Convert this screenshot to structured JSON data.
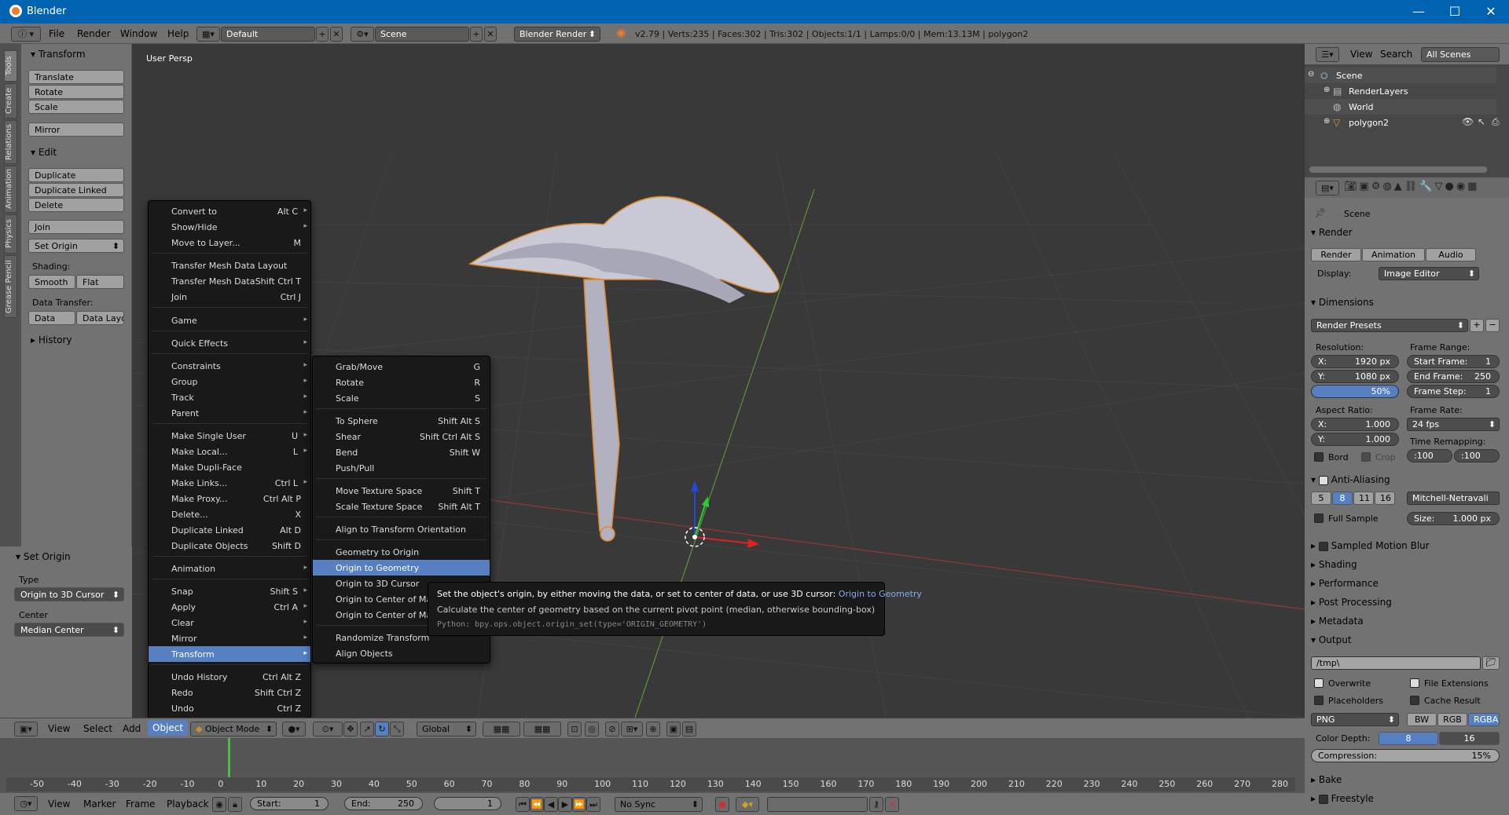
{
  "window": {
    "title": "Blender",
    "minimize": "—",
    "maximize": "☐",
    "close": "✕"
  },
  "main_header": {
    "menus": [
      "File",
      "Render",
      "Window",
      "Help"
    ],
    "layout": "Default",
    "scene": "Scene",
    "engine": "Blender Render",
    "stats": "v2.79 | Verts:235 | Faces:302 | Tris:302 | Objects:1/1 | Lamps:0/0 | Mem:13.13M | polygon2"
  },
  "left_tabs": [
    "Tools",
    "Create",
    "Relations",
    "Animation",
    "Physics",
    "Grease Pencil"
  ],
  "tool_shelf": {
    "transform_title": "Transform",
    "translate": "Translate",
    "rotate": "Rotate",
    "scale": "Scale",
    "mirror": "Mirror",
    "edit_title": "Edit",
    "duplicate": "Duplicate",
    "duplicate_linked": "Duplicate Linked",
    "delete": "Delete",
    "join": "Join",
    "set_origin": "Set Origin",
    "shading_label": "Shading:",
    "smooth": "Smooth",
    "flat": "Flat",
    "data_transfer_label": "Data Transfer:",
    "data": "Data",
    "data_layout": "Data Layo",
    "history_title": "History"
  },
  "operator_panel": {
    "title": "Set Origin",
    "type_label": "Type",
    "type_value": "Origin to 3D Cursor",
    "center_label": "Center",
    "center_value": "Median Center"
  },
  "viewport": {
    "label": "User Persp",
    "object_name": "polygon2"
  },
  "object_menu": {
    "items": [
      {
        "label": "Convert to",
        "shortcut": "Alt C",
        "arrow": "▸"
      },
      {
        "label": "Show/Hide",
        "shortcut": "",
        "arrow": "▸"
      },
      {
        "label": "Move to Layer...",
        "shortcut": "M",
        "arrow": ""
      },
      {
        "label": "Transfer Mesh Data Layout",
        "shortcut": "",
        "arrow": ""
      },
      {
        "label": "Transfer Mesh Data",
        "shortcut": "Shift Ctrl T",
        "arrow": ""
      },
      {
        "label": "Join",
        "shortcut": "Ctrl J",
        "arrow": ""
      },
      {
        "label": "Game",
        "shortcut": "",
        "arrow": "▸"
      },
      {
        "label": "Quick Effects",
        "shortcut": "",
        "arrow": "▸"
      },
      {
        "label": "Constraints",
        "shortcut": "",
        "arrow": "▸"
      },
      {
        "label": "Group",
        "shortcut": "",
        "arrow": "▸"
      },
      {
        "label": "Track",
        "shortcut": "",
        "arrow": "▸"
      },
      {
        "label": "Parent",
        "shortcut": "",
        "arrow": "▸"
      },
      {
        "label": "Make Single User",
        "shortcut": "U",
        "arrow": "▸"
      },
      {
        "label": "Make Local...",
        "shortcut": "L",
        "arrow": "▸"
      },
      {
        "label": "Make Dupli-Face",
        "shortcut": "",
        "arrow": ""
      },
      {
        "label": "Make Links...",
        "shortcut": "Ctrl L",
        "arrow": "▸"
      },
      {
        "label": "Make Proxy...",
        "shortcut": "Ctrl Alt P",
        "arrow": ""
      },
      {
        "label": "Delete...",
        "shortcut": "X",
        "arrow": ""
      },
      {
        "label": "Duplicate Linked",
        "shortcut": "Alt D",
        "arrow": ""
      },
      {
        "label": "Duplicate Objects",
        "shortcut": "Shift D",
        "arrow": ""
      },
      {
        "label": "Animation",
        "shortcut": "",
        "arrow": "▸"
      },
      {
        "label": "Snap",
        "shortcut": "Shift S",
        "arrow": "▸"
      },
      {
        "label": "Apply",
        "shortcut": "Ctrl A",
        "arrow": "▸"
      },
      {
        "label": "Clear",
        "shortcut": "",
        "arrow": "▸"
      },
      {
        "label": "Mirror",
        "shortcut": "",
        "arrow": "▸"
      },
      {
        "label": "Transform",
        "shortcut": "",
        "arrow": "▸"
      },
      {
        "label": "Undo History",
        "shortcut": "Ctrl Alt Z",
        "arrow": ""
      },
      {
        "label": "Redo",
        "shortcut": "Shift Ctrl Z",
        "arrow": ""
      },
      {
        "label": "Undo",
        "shortcut": "Ctrl Z",
        "arrow": ""
      }
    ]
  },
  "transform_menu": {
    "items": [
      {
        "label": "Grab/Move",
        "shortcut": "G"
      },
      {
        "label": "Rotate",
        "shortcut": "R"
      },
      {
        "label": "Scale",
        "shortcut": "S"
      },
      {
        "label": "To Sphere",
        "shortcut": "Shift Alt S"
      },
      {
        "label": "Shear",
        "shortcut": "Shift Ctrl Alt S"
      },
      {
        "label": "Bend",
        "shortcut": "Shift W"
      },
      {
        "label": "Push/Pull",
        "shortcut": ""
      },
      {
        "label": "Move Texture Space",
        "shortcut": "Shift T"
      },
      {
        "label": "Scale Texture Space",
        "shortcut": "Shift Alt T"
      },
      {
        "label": "Align to Transform Orientation",
        "shortcut": ""
      },
      {
        "label": "Geometry to Origin",
        "shortcut": ""
      },
      {
        "label": "Origin to Geometry",
        "shortcut": ""
      },
      {
        "label": "Origin to 3D Cursor",
        "shortcut": ""
      },
      {
        "label": "Origin to Center of Mass",
        "shortcut": ""
      },
      {
        "label": "Origin to Center of Mass",
        "shortcut": ""
      },
      {
        "label": "Randomize Transform",
        "shortcut": ""
      },
      {
        "label": "Align Objects",
        "shortcut": ""
      }
    ]
  },
  "tooltip": {
    "line1": "Set the object's origin, by either moving the data, or set to center of data, or use 3D cursor:",
    "line1_highlight": "Origin to Geometry",
    "line2": "Calculate the center of geometry based on the current pivot point (median, otherwise bounding-box)",
    "line3": "Python: bpy.ops.object.origin_set(type='ORIGIN_GEOMETRY')"
  },
  "view3d_header": {
    "view": "View",
    "select": "Select",
    "add": "Add",
    "object": "Object",
    "mode": "Object Mode",
    "orientation": "Global"
  },
  "timeline": {
    "ticks": [
      "-50",
      "-40",
      "-30",
      "-20",
      "-10",
      "0",
      "10",
      "20",
      "30",
      "40",
      "50",
      "60",
      "70",
      "80",
      "90",
      "100",
      "110",
      "120",
      "130",
      "140",
      "150",
      "160",
      "170",
      "180",
      "190",
      "200",
      "210",
      "220",
      "230",
      "240",
      "250",
      "260",
      "270",
      "280"
    ],
    "current_frame": 1,
    "view": "View",
    "marker": "Marker",
    "frame": "Frame",
    "playback": "Playback",
    "start_label": "Start:",
    "start": "1",
    "end_label": "End:",
    "end": "250",
    "current": "1",
    "sync": "No Sync"
  },
  "outliner": {
    "view": "View",
    "search": "Search",
    "filter": "All Scenes",
    "items": [
      {
        "label": "Scene"
      },
      {
        "label": "RenderLayers"
      },
      {
        "label": "World"
      },
      {
        "label": "polygon2"
      }
    ]
  },
  "properties": {
    "context": "Scene",
    "render_title": "Render",
    "render_btn": "Render",
    "animation_btn": "Animation",
    "audio_btn": "Audio",
    "display_label": "Display:",
    "display_value": "Image Editor",
    "dimensions_title": "Dimensions",
    "render_presets": "Render Presets",
    "resolution_label": "Resolution:",
    "res_x": "X:",
    "res_x_val": "1920 px",
    "res_y": "Y:",
    "res_y_val": "1080 px",
    "res_pct": "50%",
    "frame_range_label": "Frame Range:",
    "start_frame": "Start Frame:",
    "start_frame_val": "1",
    "end_frame": "End Frame:",
    "end_frame_val": "250",
    "frame_step": "Frame Step:",
    "frame_step_val": "1",
    "aspect_label": "Aspect Ratio:",
    "asp_x": "X:",
    "asp_x_val": "1.000",
    "asp_y": "Y:",
    "asp_y_val": "1.000",
    "frame_rate_label": "Frame Rate:",
    "fps": "24 fps",
    "time_remap_label": "Time Remapping:",
    "remap_old": ":100",
    "remap_new": ":100",
    "bord": "Bord",
    "crop": "Crop",
    "aa_title": "Anti-Aliasing",
    "aa_samples": [
      "5",
      "8",
      "11",
      "16"
    ],
    "aa_filter": "Mitchell-Netravali",
    "full_sample": "Full Sample",
    "size_label": "Size:",
    "size_val": "1.000 px",
    "sampled_motion_blur": "Sampled Motion Blur",
    "shading": "Shading",
    "performance": "Performance",
    "post_processing": "Post Processing",
    "metadata": "Metadata",
    "output": "Output",
    "output_path": "/tmp\\",
    "overwrite": "Overwrite",
    "file_extensions": "File Extensions",
    "placeholders": "Placeholders",
    "cache_result": "Cache Result",
    "format": "PNG",
    "bw": "BW",
    "rgb": "RGB",
    "rgba": "RGBA",
    "color_depth": "Color Depth:",
    "depth8": "8",
    "depth16": "16",
    "compression_label": "Compression:",
    "compression_val": "15%",
    "bake": "Bake",
    "freestyle": "Freestyle"
  },
  "colors": {
    "titlebar": "#0063b1",
    "highlight": "#5680c2",
    "viewport": "#393939",
    "panel": "#727272"
  }
}
